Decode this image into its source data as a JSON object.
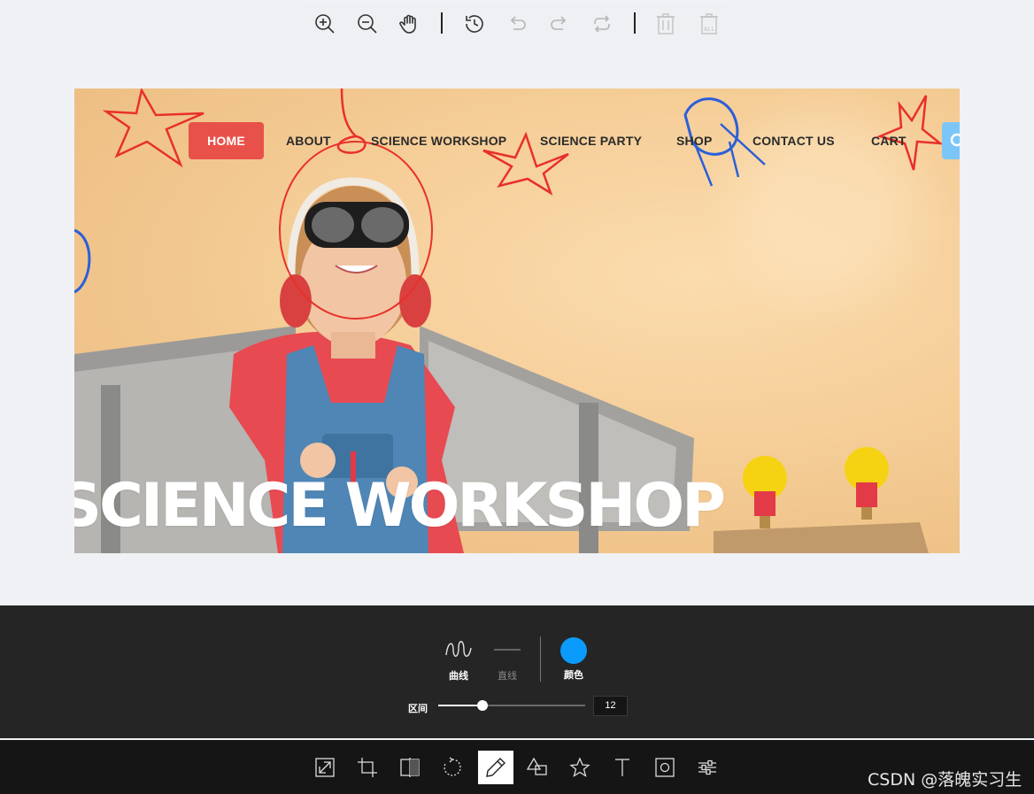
{
  "top_toolbar": {
    "buttons": [
      "zoom-in",
      "zoom-out",
      "hand",
      "history",
      "undo",
      "redo",
      "reset",
      "delete",
      "delete-all"
    ]
  },
  "canvas": {
    "nav": [
      "HOME",
      "ABOUT",
      "SCIENCE WORKSHOP",
      "SCIENCE PARTY",
      "SHOP",
      "CONTACT US",
      "CART"
    ],
    "hero_title": "SCIENCE WORKSHOP",
    "colors": {
      "home_bg": "#e8514a",
      "search_bg": "#7cc6f7",
      "drawing_red": "#e8302a",
      "drawing_blue": "#2b5fd9"
    }
  },
  "draw_panel": {
    "curve_label": "曲线",
    "line_label": "直线",
    "color_label": "颜色",
    "range_label": "区间",
    "range_value": "12",
    "slider_fraction": 0.3,
    "selected_color": "#0a9bfc"
  },
  "main_toolbar": {
    "tools": [
      "resize",
      "crop",
      "flip",
      "rotate",
      "draw",
      "shape",
      "icon",
      "text",
      "mask",
      "filter"
    ],
    "active_tool": "draw"
  },
  "watermark": "CSDN @落魄实习生"
}
